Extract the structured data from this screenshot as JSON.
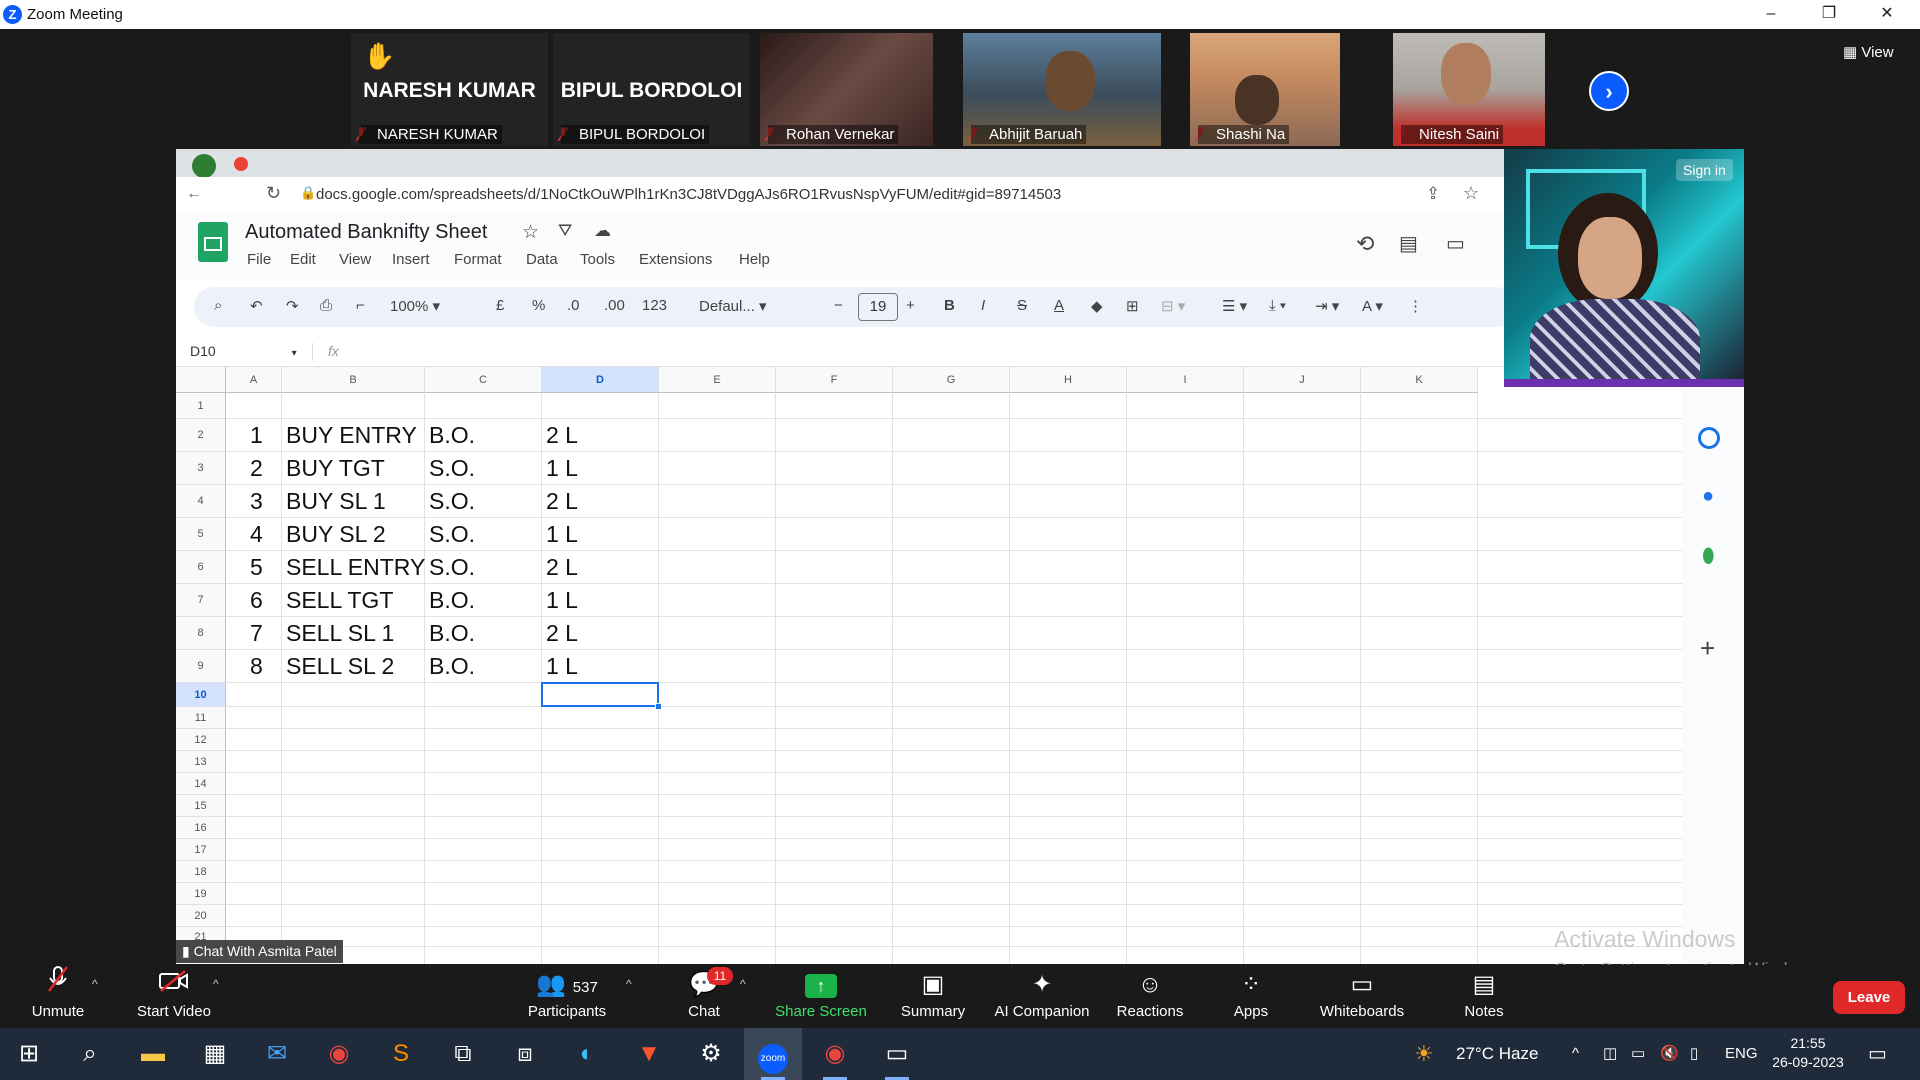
{
  "window": {
    "title": "Zoom Meeting",
    "controls": [
      "–",
      "❐",
      "✕"
    ]
  },
  "gallery": {
    "tiles": [
      {
        "display_name": "NARESH KUMAR",
        "label": "NARESH KUMAR",
        "raised_hand": true
      },
      {
        "display_name": "BIPUL BORDOLOI",
        "label": "BIPUL BORDOLOI"
      },
      {
        "label": "Rohan Vernekar"
      },
      {
        "label": "Abhijit Baruah"
      },
      {
        "label": "Shashi Na"
      },
      {
        "label": "Nitesh Saini"
      }
    ],
    "next_icon": "›",
    "view_label": "View"
  },
  "browser": {
    "url": "docs.google.com/spreadsheets/d/1NoCtkOuWPlh1rKn3CJ8tVDggAJs6RO1RvusNspVyFUM/edit#gid=89714503",
    "sign_in": "Sign in"
  },
  "sheet": {
    "title": "Automated Banknifty Sheet",
    "menus": [
      "File",
      "Edit",
      "View",
      "Insert",
      "Format",
      "Data",
      "Tools",
      "Extensions",
      "Help"
    ],
    "toolbar": {
      "zoom": "100%",
      "currency": "£",
      "percent": "%",
      "dec_dec": ".0",
      "inc_dec": ".00",
      "number_format": "123",
      "font": "Defaul...",
      "font_size": "19",
      "bold": "B",
      "italic": "I",
      "strike": "S",
      "text_color": "A"
    },
    "name_box": "D10",
    "fx": "fx",
    "columns": [
      "A",
      "B",
      "C",
      "D",
      "E",
      "F",
      "G",
      "H",
      "I",
      "J",
      "K"
    ],
    "selected_column": "D",
    "row_numbers": [
      "1",
      "2",
      "3",
      "4",
      "5",
      "6",
      "7",
      "8",
      "9",
      "10",
      "11",
      "12",
      "13",
      "14",
      "15",
      "16",
      "17",
      "18",
      "19",
      "20",
      "21"
    ],
    "selected_row": "10",
    "rows": [
      {
        "a": "1",
        "b": "BUY ENTRY",
        "c": "B.O.",
        "d": "2 L"
      },
      {
        "a": "2",
        "b": "BUY TGT",
        "c": "S.O.",
        "d": "1 L"
      },
      {
        "a": "3",
        "b": "BUY SL 1",
        "c": "S.O.",
        "d": "2 L"
      },
      {
        "a": "4",
        "b": "BUY SL 2",
        "c": "S.O.",
        "d": "1 L"
      },
      {
        "a": "5",
        "b": "SELL ENTRY",
        "c": "S.O.",
        "d": "2 L"
      },
      {
        "a": "6",
        "b": "SELL TGT",
        "c": "B.O.",
        "d": "1 L"
      },
      {
        "a": "7",
        "b": "SELL SL 1",
        "c": "B.O.",
        "d": "2 L"
      },
      {
        "a": "8",
        "b": "SELL SL 2",
        "c": "B.O.",
        "d": "1 L"
      }
    ]
  },
  "chat_with": "Chat With Asmita Patel",
  "watermark": {
    "line1": "Activate Windows",
    "line2": "Go to Settings to activate Windows."
  },
  "zoom_toolbar": {
    "unmute": "Unmute",
    "start_video": "Start Video",
    "participants": "Participants",
    "participants_count": "537",
    "chat": "Chat",
    "chat_badge": "11",
    "share_screen": "Share Screen",
    "summary": "Summary",
    "ai_companion": "AI Companion",
    "reactions": "Reactions",
    "apps": "Apps",
    "whiteboards": "Whiteboards",
    "notes": "Notes",
    "leave": "Leave"
  },
  "taskbar": {
    "weather": "27°C Haze",
    "language": "ENG",
    "time": "21:55",
    "date": "26-09-2023"
  }
}
